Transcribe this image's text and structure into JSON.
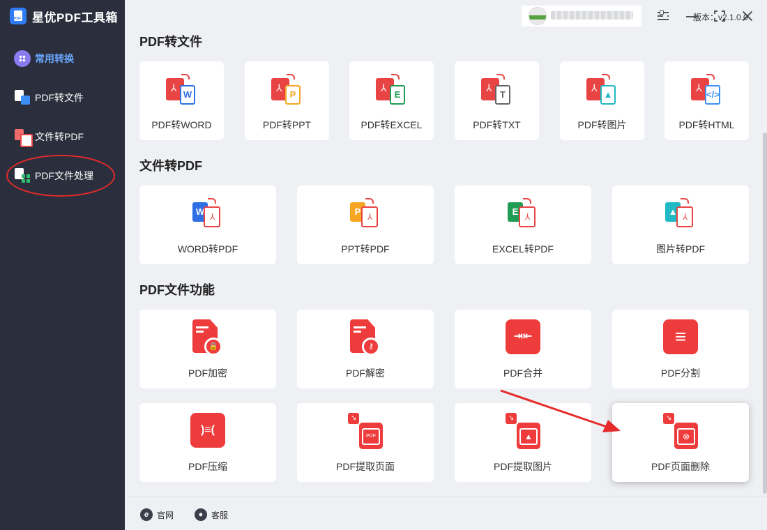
{
  "app": {
    "name": "星优PDF工具箱"
  },
  "sidebar": {
    "items": [
      {
        "label": "常用转换",
        "icon": "common-convert-icon",
        "active": true
      },
      {
        "label": "PDF转文件",
        "icon": "pdf-to-file-icon"
      },
      {
        "label": "文件转PDF",
        "icon": "file-to-pdf-icon"
      },
      {
        "label": "PDF文件处理",
        "icon": "pdf-process-icon"
      }
    ]
  },
  "sections": {
    "pdf_to_file": {
      "title": "PDF转文件",
      "items": [
        {
          "label": "PDF转WORD",
          "letter": "W",
          "color": "#2f6fe4"
        },
        {
          "label": "PDF转PPT",
          "letter": "P",
          "color": "#f5a623"
        },
        {
          "label": "PDF转EXCEL",
          "letter": "E",
          "color": "#1f9d55"
        },
        {
          "label": "PDF转TXT",
          "letter": "T",
          "color": "#666666"
        },
        {
          "label": "PDF转图片",
          "letter": "▲",
          "color": "#20b9c4"
        },
        {
          "label": "PDF转HTML",
          "letter": "</>",
          "color": "#3b8ff6"
        }
      ]
    },
    "file_to_pdf": {
      "title": "文件转PDF",
      "items": [
        {
          "label": "WORD转PDF",
          "letter": "W",
          "color": "#2f6fe4"
        },
        {
          "label": "PPT转PDF",
          "letter": "P",
          "color": "#f5a623"
        },
        {
          "label": "EXCEL转PDF",
          "letter": "E",
          "color": "#1f9d55"
        },
        {
          "label": "图片转PDF",
          "letter": "▲",
          "color": "#20b9c4"
        }
      ]
    },
    "pdf_functions": {
      "title": "PDF文件功能",
      "items": [
        {
          "label": "PDF加密",
          "glyph": "🔒"
        },
        {
          "label": "PDF解密",
          "glyph": "⚷"
        },
        {
          "label": "PDF合并",
          "glyph": "⇥⇤"
        },
        {
          "label": "PDF分割",
          "glyph": "≡"
        },
        {
          "label": "PDF压缩",
          "glyph": ")≡("
        },
        {
          "label": "PDF提取页面",
          "glyph": "PDF"
        },
        {
          "label": "PDF提取图片",
          "glyph": "▲"
        },
        {
          "label": "PDF页面删除",
          "glyph": "⊗",
          "selected": true
        }
      ]
    }
  },
  "footer": {
    "website": "官网",
    "support": "客服",
    "version": "版本：v2.1.0.0"
  },
  "colors": {
    "accent": "#ee3b3b",
    "sidebar_bg": "#2b2f3d",
    "active_nav": "#6aa7ff",
    "annotation": "#e52a2a"
  }
}
